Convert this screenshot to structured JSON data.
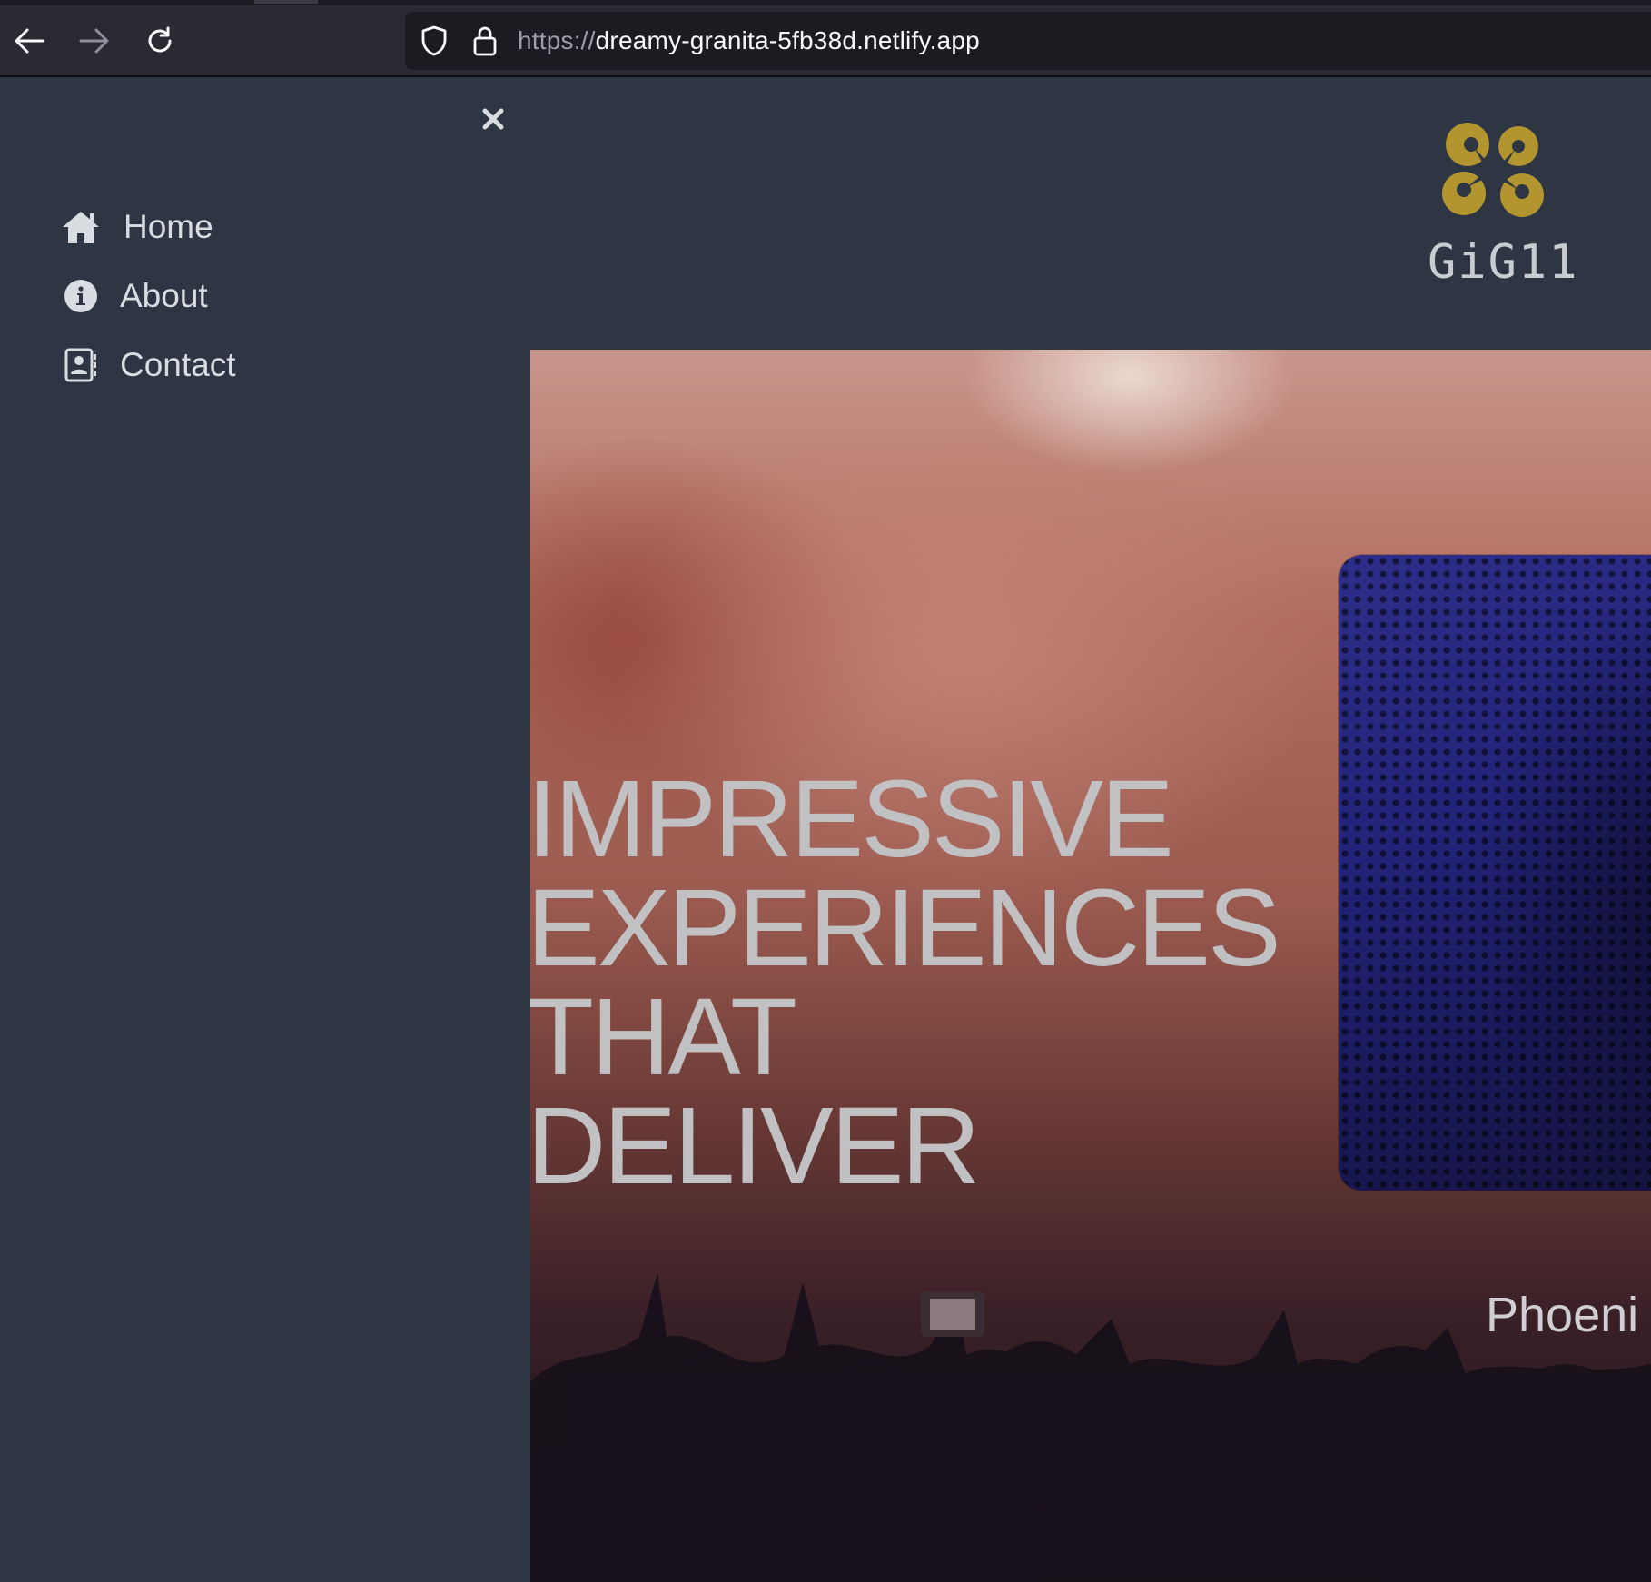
{
  "browser": {
    "url_scheme": "https://",
    "url_host": "dreamy-granita-5fb38d.netlify.app"
  },
  "sidebar": {
    "items": [
      {
        "label": "Home",
        "icon": "home-icon"
      },
      {
        "label": "About",
        "icon": "info-icon"
      },
      {
        "label": "Contact",
        "icon": "contact-card-icon"
      }
    ]
  },
  "logo": {
    "text": "GiG11",
    "color": "#b2952e"
  },
  "hero": {
    "title_lines": [
      "IMPRESSIVE",
      "EXPERIENCES",
      "THAT",
      "DELIVER"
    ],
    "card_city": "Phoeni"
  },
  "colors": {
    "page_bg": "#2d3642",
    "menu_text": "#d9dde2",
    "hero_text": "#c1c1c4",
    "card_bg": "#23237a"
  }
}
